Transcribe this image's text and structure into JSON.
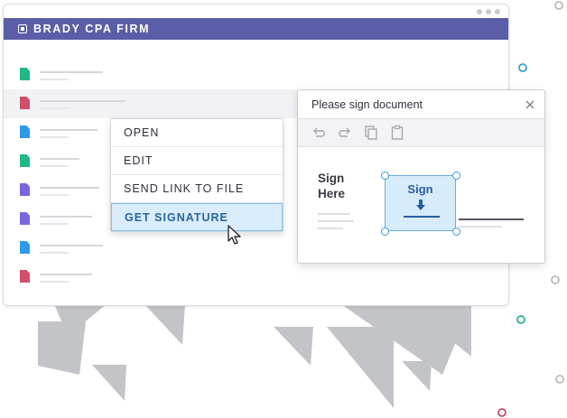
{
  "window": {
    "firm_name": "BRADY CPA FIRM"
  },
  "files": [
    {
      "icon": "file-icon",
      "color": "#21b888"
    },
    {
      "icon": "file-icon",
      "color": "#d0506c"
    },
    {
      "icon": "file-icon",
      "color": "#2f9be8"
    },
    {
      "icon": "file-icon",
      "color": "#21b888"
    },
    {
      "icon": "file-icon",
      "color": "#7c66e0"
    },
    {
      "icon": "file-icon",
      "color": "#7c66e0"
    },
    {
      "icon": "file-icon",
      "color": "#2f9be8"
    },
    {
      "icon": "file-icon",
      "color": "#d0506c"
    }
  ],
  "context_menu": {
    "items": [
      {
        "label": "OPEN"
      },
      {
        "label": "EDIT"
      },
      {
        "label": "SEND LINK TO FILE"
      },
      {
        "label": "GET SIGNATURE",
        "active": true
      }
    ]
  },
  "dialog": {
    "title": "Please sign document",
    "sign_here": "Sign Here",
    "sign_button": "Sign"
  },
  "colors": {
    "title_bar": "#5b5ea6",
    "accent": "#2a64a0",
    "highlight": "#d8ecfb"
  }
}
